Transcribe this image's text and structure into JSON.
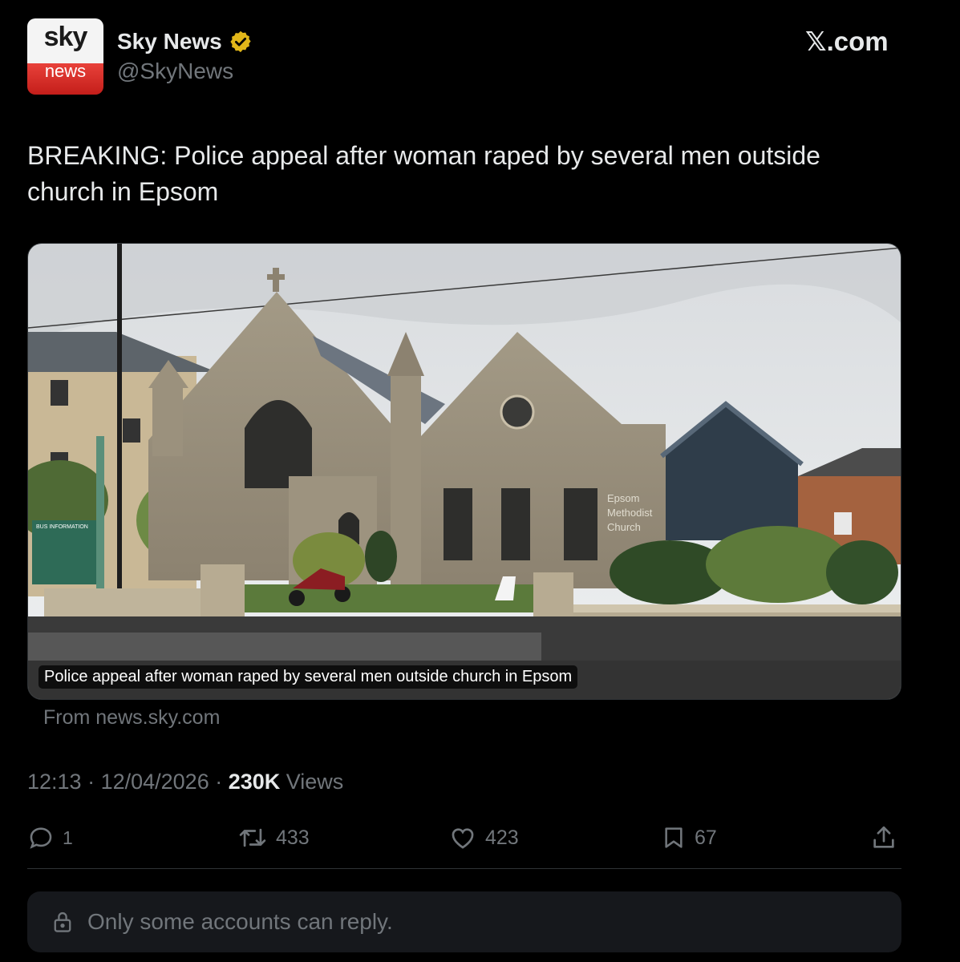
{
  "author": {
    "avatar_top": "sky",
    "avatar_bottom": "news",
    "display_name": "Sky News",
    "verified_icon": "gold-verified-badge-icon",
    "handle": "@SkyNews"
  },
  "brand": {
    "x_glyph": "𝕏",
    "label": ".com"
  },
  "tweet": {
    "text": "BREAKING: Police appeal after woman raped by several men outside church in Epsom"
  },
  "card": {
    "caption": "Police appeal after woman raped by several men outside church in Epsom",
    "source": "From news.sky.com",
    "sign_line1": "Epsom",
    "sign_line2": "Methodist",
    "sign_line3": "Church",
    "bus_board_label": "BUS INFORMATION"
  },
  "meta": {
    "time": "12:13",
    "sep1": " · ",
    "date": "12/04/2026",
    "sep2": " · ",
    "views_count": "230K",
    "views_label": " Views"
  },
  "actions": {
    "reply": {
      "icon": "reply-icon",
      "count": "1"
    },
    "repost": {
      "icon": "repost-icon",
      "count": "433"
    },
    "like": {
      "icon": "like-icon",
      "count": "423"
    },
    "bookmark": {
      "icon": "bookmark-icon",
      "count": "67"
    },
    "share": {
      "icon": "share-icon"
    }
  },
  "reply_restriction": {
    "icon": "lock-icon",
    "text": "Only some accounts can reply."
  },
  "colors": {
    "background": "#000000",
    "text": "#e7e9ea",
    "muted": "#71767b",
    "verified_gold": "#e2b719",
    "sky_red": "#d62b25"
  }
}
